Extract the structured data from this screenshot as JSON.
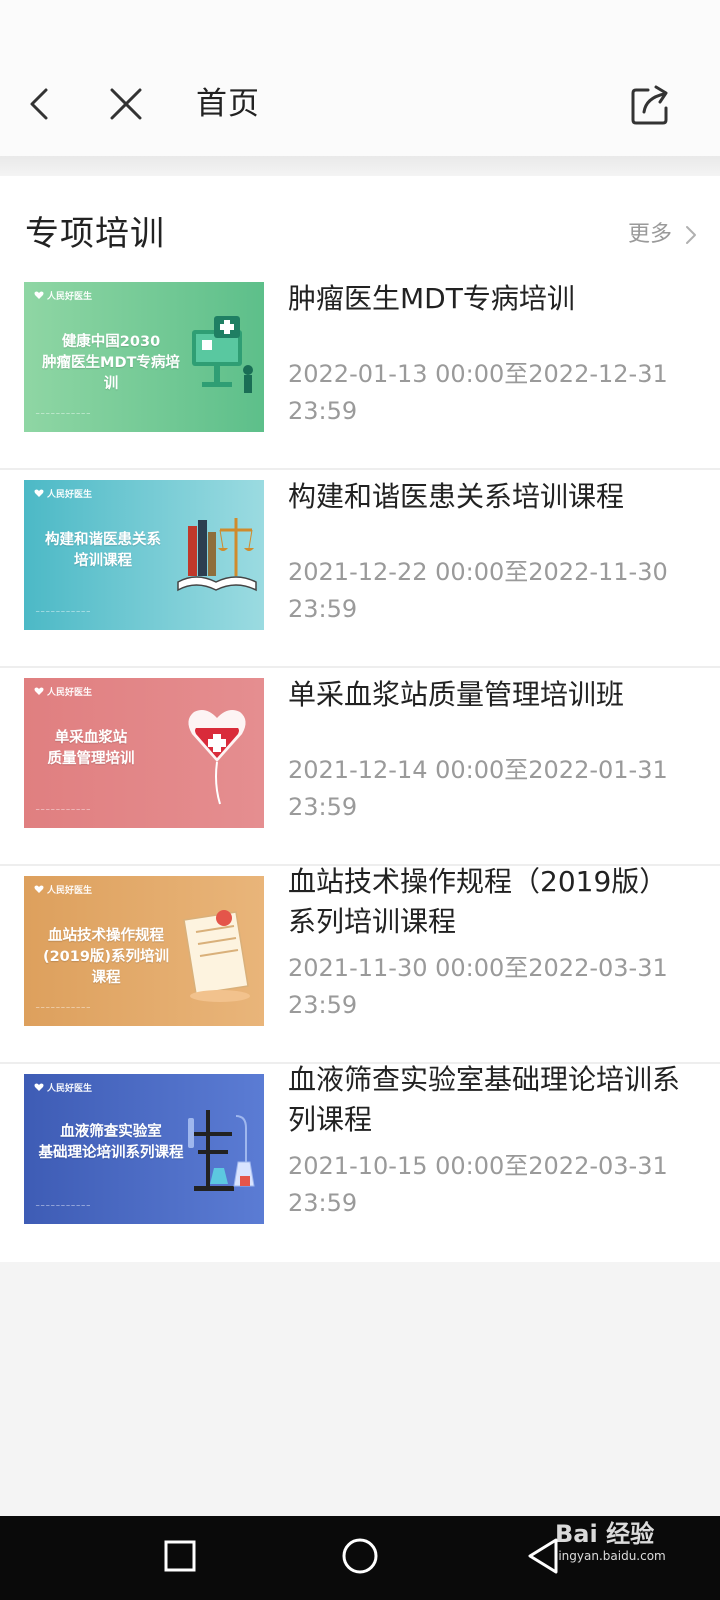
{
  "header": {
    "title": "首页"
  },
  "section": {
    "title": "专项培训",
    "more_label": "更多"
  },
  "courses": [
    {
      "name": "肿瘤医生MDT专病培训",
      "dates": "2022-01-13 00:00至2022-12-31 23:59",
      "thumb_title": "健康中国2030 肿瘤医生MDT专病培训",
      "thumb_color_start": "#8fd6a4",
      "thumb_color_end": "#5dbf8a"
    },
    {
      "name": "构建和谐医患关系培训课程",
      "dates": "2021-12-22 00:00至2022-11-30 23:59",
      "thumb_title": "构建和谐医患关系 培训课程",
      "thumb_color_start": "#4cb9c6",
      "thumb_color_end": "#9bdbe1"
    },
    {
      "name": "单采血浆站质量管理培训班",
      "dates": "2021-12-14 00:00至2022-01-31 23:59",
      "thumb_title": "单采血浆站 质量管理培训",
      "thumb_color_start": "#e07f80",
      "thumb_color_end": "#e58e90"
    },
    {
      "name": "血站技术操作规程（2019版）系列培训课程",
      "dates": "2021-11-30 00:00至2022-03-31 23:59",
      "thumb_title": "血站技术操作规程 (2019版)系列培训课程",
      "thumb_color_start": "#dda05d",
      "thumb_color_end": "#e9b57a"
    },
    {
      "name": "血液筛查实验室基础理论培训系列课程",
      "dates": "2021-10-15 00:00至2022-03-31 23:59",
      "thumb_title": "血液筛查实验室 基础理论培训系列课程",
      "thumb_color_start": "#3e5cb5",
      "thumb_color_end": "#5b7cd4"
    }
  ],
  "thumb_brand": "人民好医生",
  "watermark": {
    "text": "Bai 经验",
    "url": "jingyan.baidu.com"
  },
  "icons": {
    "back": "chevron-left-icon",
    "close": "close-icon",
    "share": "share-icon",
    "more": "chevron-right-icon",
    "nav_recent": "square-icon",
    "nav_home": "circle-icon",
    "nav_back": "triangle-back-icon"
  }
}
